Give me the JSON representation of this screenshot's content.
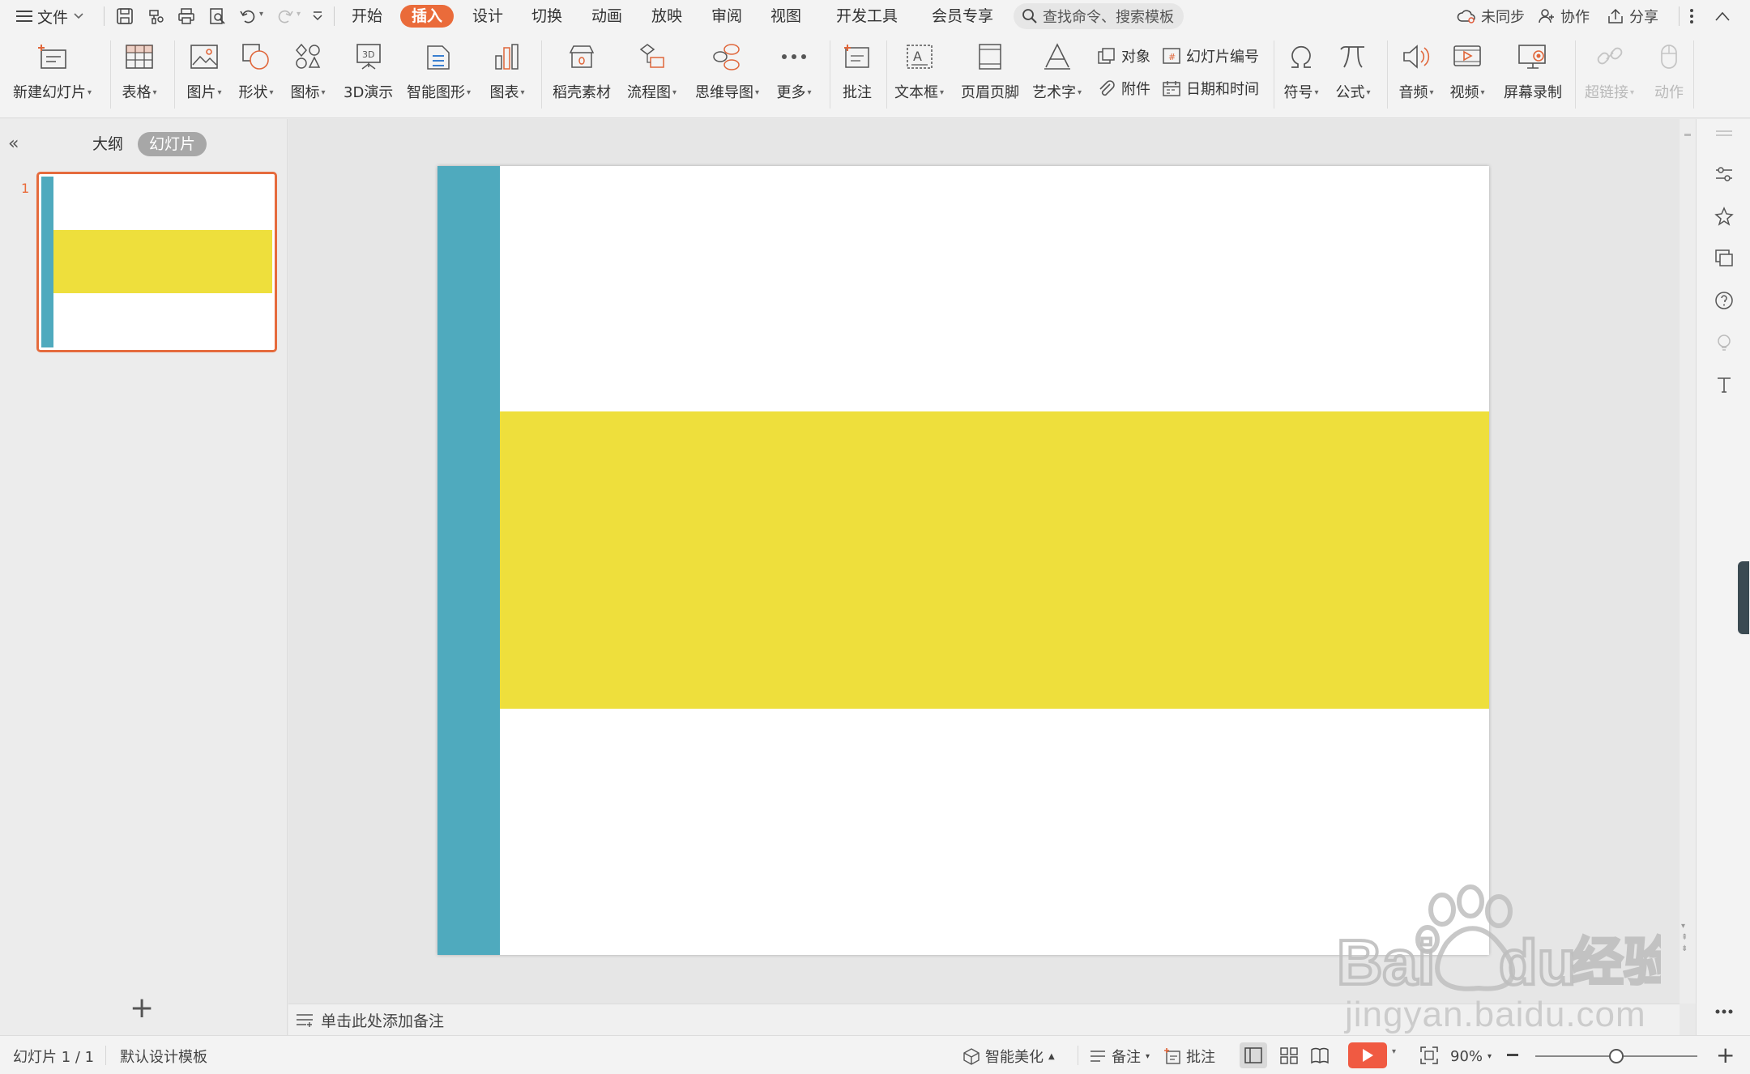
{
  "menubar": {
    "file_label": "文件",
    "tabs": [
      "开始",
      "插入",
      "设计",
      "切换",
      "动画",
      "放映",
      "审阅",
      "视图",
      "开发工具",
      "会员专享"
    ],
    "active_tab": "插入",
    "search_placeholder": "查找命令、搜索模板",
    "sync_label": "未同步",
    "collab_label": "协作",
    "share_label": "分享"
  },
  "ribbon": {
    "new_slide": "新建幻灯片",
    "table": "表格",
    "picture": "图片",
    "shape": "形状",
    "icon": "图标",
    "threed": "3D演示",
    "smartart": "智能图形",
    "chart": "图表",
    "material": "稻壳素材",
    "flowchart": "流程图",
    "mindmap": "思维导图",
    "more": "更多",
    "comment": "批注",
    "textbox": "文本框",
    "header_footer": "页眉页脚",
    "wordart": "艺术字",
    "object": "对象",
    "attachment": "附件",
    "slide_number": "幻灯片编号",
    "datetime": "日期和时间",
    "symbol": "符号",
    "formula": "公式",
    "audio": "音频",
    "video": "视频",
    "screen_record": "屏幕录制",
    "hyperlink": "超链接",
    "action": "动作"
  },
  "leftpanel": {
    "tab_outline": "大纲",
    "tab_slides": "幻灯片",
    "slide_number": "1"
  },
  "slide": {
    "sidebar_color": "#4faabe",
    "band_color": "#eedf3c",
    "background": "#ffffff"
  },
  "notes": {
    "placeholder": "单击此处添加备注"
  },
  "statusbar": {
    "slide_info": "幻灯片 1 / 1",
    "template": "默认设计模板",
    "beautify": "智能美化",
    "notes": "备注",
    "comments": "批注",
    "zoom": "90%",
    "zoom_level": 0.5
  },
  "watermark": {
    "text": "jingyan.baidu.com"
  }
}
